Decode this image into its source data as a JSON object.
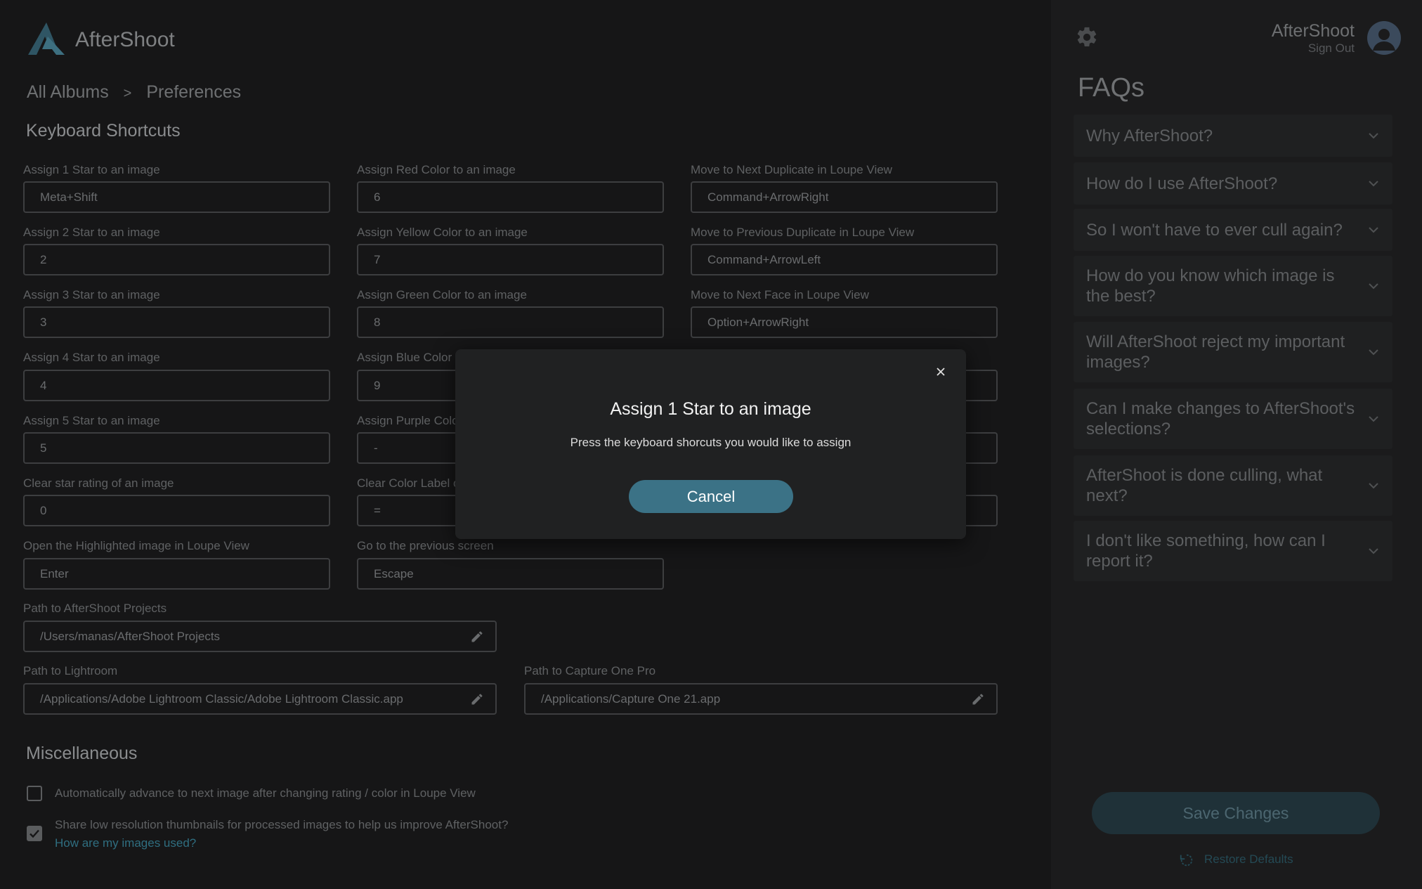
{
  "app": {
    "brand": "AfterShoot"
  },
  "breadcrumb": {
    "root": "All Albums",
    "separator": ">",
    "current": "Preferences"
  },
  "keyboard_section": {
    "title": "Keyboard Shortcuts",
    "col1": [
      {
        "label": "Assign 1 Star to an image",
        "value": "Meta+Shift"
      },
      {
        "label": "Assign 2 Star to an image",
        "value": "2"
      },
      {
        "label": "Assign 3 Star to an image",
        "value": "3"
      },
      {
        "label": "Assign 4 Star to an image",
        "value": "4"
      },
      {
        "label": "Assign 5 Star to an image",
        "value": "5"
      },
      {
        "label": "Clear star rating of an image",
        "value": "0"
      },
      {
        "label": "Open the Highlighted image in Loupe View",
        "value": "Enter"
      }
    ],
    "col2": [
      {
        "label": "Assign Red Color to an image",
        "value": "6"
      },
      {
        "label": "Assign Yellow Color to an image",
        "value": "7"
      },
      {
        "label": "Assign Green Color to an image",
        "value": "8"
      },
      {
        "label": "Assign Blue Color t",
        "value": "9"
      },
      {
        "label": "Assign Purple Colo",
        "value": "-"
      },
      {
        "label": "Clear Color Label o",
        "value": "="
      },
      {
        "label": "Go to the previous screen",
        "value": "Escape"
      }
    ],
    "col3": [
      {
        "label": "Move to Next Duplicate in Loupe View",
        "value": "Command+ArrowRight"
      },
      {
        "label": "Move to Previous Duplicate in Loupe View",
        "value": "Command+ArrowLeft"
      },
      {
        "label": "Move to Next Face in Loupe View",
        "value": "Option+ArrowRight"
      }
    ]
  },
  "paths": {
    "projects": {
      "label": "Path to AfterShoot Projects",
      "value": "/Users/manas/AfterShoot Projects"
    },
    "lightroom": {
      "label": "Path to Lightroom",
      "value": "/Applications/Adobe Lightroom Classic/Adobe Lightroom Classic.app"
    },
    "capture_one": {
      "label": "Path to Capture One Pro",
      "value": "/Applications/Capture One 21.app"
    }
  },
  "misc": {
    "title": "Miscellaneous",
    "auto_advance": {
      "label": "Automatically advance to next image after changing rating / color in Loupe View",
      "checked": false
    },
    "share_thumbnails": {
      "label": "Share low resolution thumbnails for processed images to help us improve AfterShoot?",
      "checked": true
    },
    "link": "How are my images used?"
  },
  "user": {
    "name": "AfterShoot",
    "signout": "Sign Out"
  },
  "faq": {
    "title": "FAQs",
    "items": [
      {
        "q": "Why AfterShoot?"
      },
      {
        "q": "How do I use AfterShoot?"
      },
      {
        "q": "So I won't have to ever cull again?"
      },
      {
        "q": "How do you know which image is the best?"
      },
      {
        "q": "Will AfterShoot reject my important images?"
      },
      {
        "q": "Can I make changes to AfterShoot's selections?"
      },
      {
        "q": "AfterShoot is done culling, what next?"
      },
      {
        "q": "I don't like something, how can I report it?"
      }
    ]
  },
  "actions": {
    "save": "Save Changes",
    "restore": "Restore Defaults"
  },
  "modal": {
    "title": "Assign 1 Star to an image",
    "text": "Press the keyboard shorcuts you would like to assign",
    "cancel": "Cancel"
  },
  "colors": {
    "accent": "#3b7286",
    "background": "#161617",
    "modal": "#202122"
  }
}
